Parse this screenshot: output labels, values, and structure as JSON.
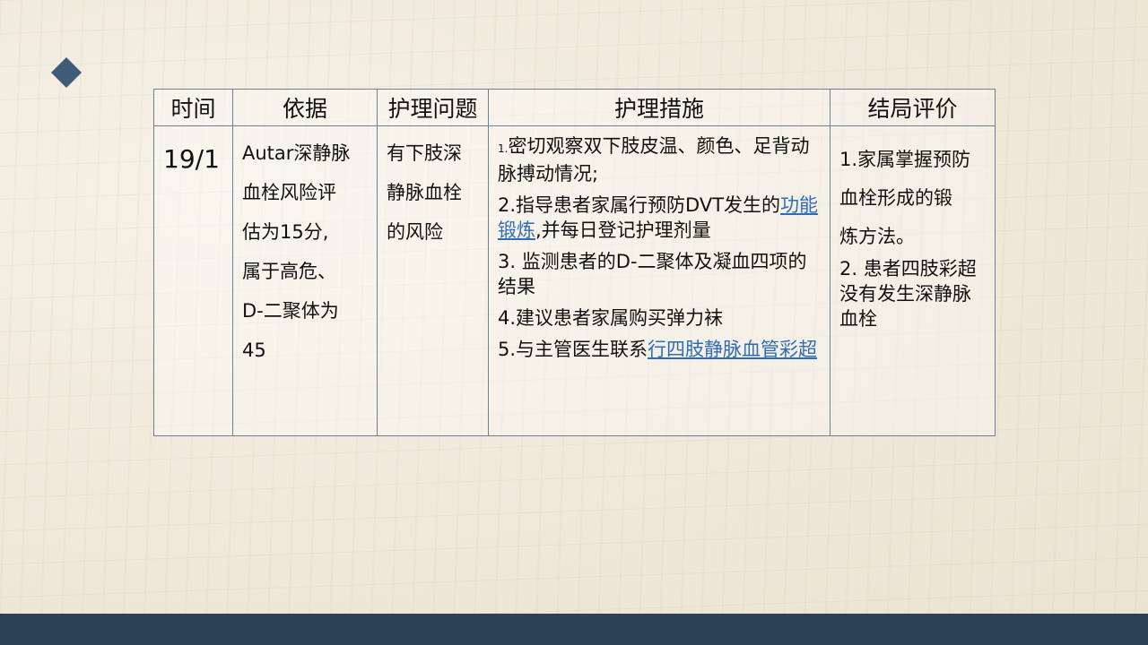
{
  "table": {
    "headers": [
      "时间",
      "依据",
      "护理问题",
      "护理措施",
      "结局评价"
    ],
    "time": "19/1",
    "basis": [
      "Autar深静脉",
      "血栓风险评",
      "估为15分,",
      "属于高危、",
      "D-二聚体为",
      "45"
    ],
    "problem": [
      "有下肢深",
      "静脉血栓",
      "的风险"
    ],
    "measures": {
      "m1_num": "1.",
      "m1_text": "密切观察双下肢皮温、颜色、足背动脉搏动情况;",
      "m2_text": "2.指导患者家属行预防DVT发生的",
      "m2_link": "功能锻炼",
      "m2_rest": ",并每日登记护理剂量",
      "m3": "3. 监测患者的D-二聚体及凝血四项的结果",
      "m4": "4.建议患者家属购买弹力袜",
      "m5_text": "5.与主管医生联系",
      "m5_link": "行四肢静脉血管彩超"
    },
    "outcome": {
      "o1_lines": [
        "1.家属掌握预防",
        "血栓形成的锻",
        "炼方法。"
      ],
      "o2": "2. 患者四肢彩超没有发生深静脉血栓"
    }
  },
  "colors": {
    "accent": "#3f5b78",
    "footer": "#2e4257",
    "link": "#2f6db3",
    "border": "#6f7f95"
  }
}
